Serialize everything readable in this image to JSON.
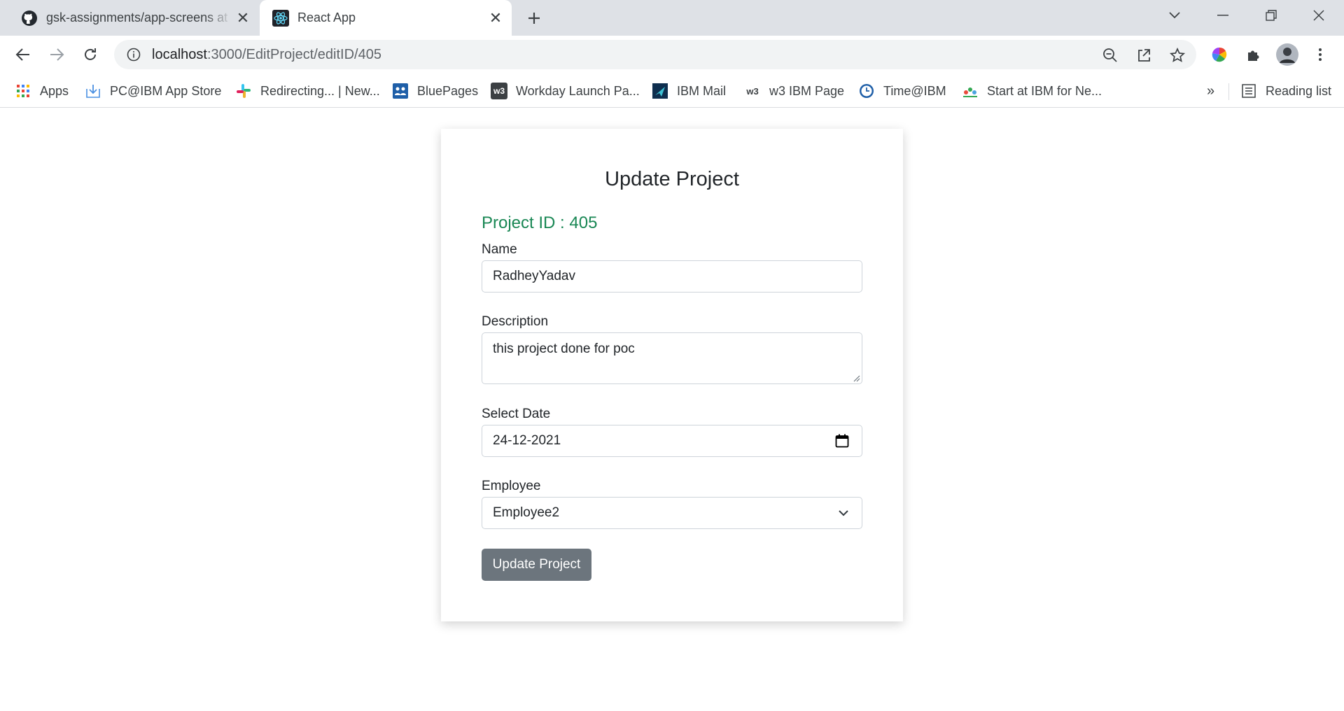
{
  "browser": {
    "tabs": [
      {
        "title": "gsk-assignments/app-screens at",
        "favicon": "github-icon",
        "active": false
      },
      {
        "title": "React App",
        "favicon": "react-icon",
        "active": true
      }
    ],
    "address": {
      "host": "localhost",
      "path": ":3000/EditProject/editID/405"
    },
    "bookmarks": [
      {
        "label": "Apps",
        "icon": "apps-grid-icon"
      },
      {
        "label": "PC@IBM App Store",
        "icon": "download-tray-icon"
      },
      {
        "label": "Redirecting... | New...",
        "icon": "slack-icon"
      },
      {
        "label": "BluePages",
        "icon": "people-icon"
      },
      {
        "label": "Workday Launch Pa...",
        "icon": "w3-icon"
      },
      {
        "label": "IBM Mail",
        "icon": "ibm-mail-icon"
      },
      {
        "label": "w3 IBM Page",
        "icon": "w3-text-icon",
        "icon_text": "w3"
      },
      {
        "label": "Time@IBM",
        "icon": "clock-icon"
      },
      {
        "label": "Start at IBM for Ne...",
        "icon": "start-ibm-icon"
      }
    ],
    "overflow_label": "»",
    "reading_list_label": "Reading list"
  },
  "page": {
    "title": "Update Project",
    "project_id_text": "Project ID : 405",
    "fields": {
      "name": {
        "label": "Name",
        "value": "RadheyYadav"
      },
      "description": {
        "label": "Description",
        "value": "this project done for poc"
      },
      "date": {
        "label": "Select Date",
        "value": "24-12-2021"
      },
      "employee": {
        "label": "Employee",
        "value": "Employee2"
      }
    },
    "submit_label": "Update Project"
  },
  "colors": {
    "project_id": "#198754",
    "button": "#6c757d",
    "tabstrip": "#dee1e6"
  }
}
